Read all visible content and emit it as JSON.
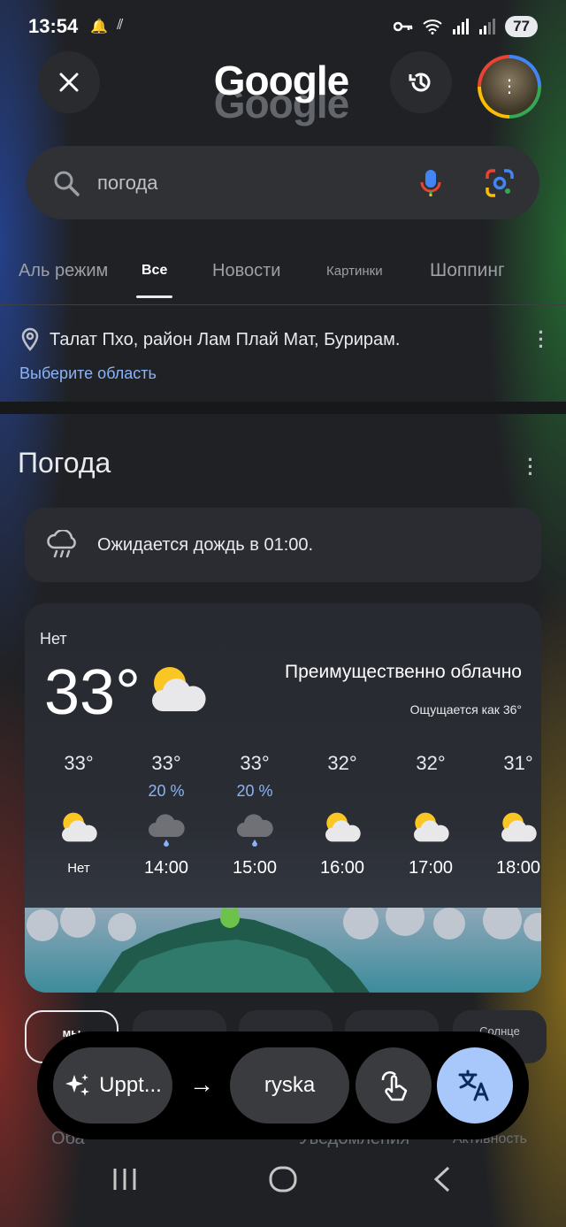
{
  "status_bar": {
    "time": "13:54",
    "battery": "77"
  },
  "header": {
    "logo": "Google"
  },
  "search": {
    "query": "погода"
  },
  "tabs": [
    {
      "label": "Аль режим"
    },
    {
      "label": "Все"
    },
    {
      "label": "Новости"
    },
    {
      "label": "Картинки"
    },
    {
      "label": "Шоппинг"
    }
  ],
  "location": {
    "text": "Талат Пхо, район Лам Плай Мат, Бурирам.",
    "link": "Выберите область"
  },
  "weather": {
    "title": "Погода",
    "alert": "Ожидается дождь в 01:00.",
    "current": {
      "label": "Нет",
      "temp": "33°",
      "condition": "Преимущественно облачно",
      "feels_like": "Ощущается как 36°"
    },
    "hourly": [
      {
        "temp": "33°",
        "precip": "",
        "icon": "partly-cloudy-icon",
        "time": "Нет"
      },
      {
        "temp": "33°",
        "precip": "20 %",
        "icon": "rain-cloud-icon",
        "time": "14:00"
      },
      {
        "temp": "33°",
        "precip": "20 %",
        "icon": "rain-cloud-icon",
        "time": "15:00"
      },
      {
        "temp": "32°",
        "precip": "",
        "icon": "partly-cloudy-icon",
        "time": "16:00"
      },
      {
        "temp": "32°",
        "precip": "",
        "icon": "partly-cloudy-icon",
        "time": "17:00"
      },
      {
        "temp": "31°",
        "precip": "",
        "icon": "partly-cloudy-icon",
        "time": "18:00"
      }
    ],
    "chips": [
      "мы",
      "",
      "",
      "",
      "Солнце"
    ]
  },
  "bottom_nav": [
    "Оба",
    "Уведомления",
    "Активность"
  ],
  "translate_bar": {
    "source": "Uppt...",
    "target": "ryska"
  },
  "colors": {
    "accent": "#8ab4f8",
    "translate_button": "#a8c7fa"
  }
}
